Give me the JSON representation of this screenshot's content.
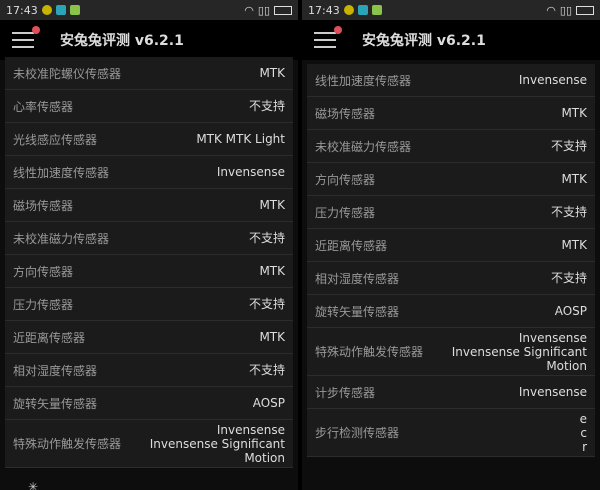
{
  "status": {
    "time": "17:43"
  },
  "header": {
    "title": "安兔兔评测 v6.2.1"
  },
  "left_rows": [
    {
      "name": "未校准陀螺仪传感器",
      "value": "MTK"
    },
    {
      "name": "心率传感器",
      "value": "不支持"
    },
    {
      "name": "光线感应传感器",
      "value": "MTK MTK Light"
    },
    {
      "name": "线性加速度传感器",
      "value": "Invensense"
    },
    {
      "name": "磁场传感器",
      "value": "MTK"
    },
    {
      "name": "未校准磁力传感器",
      "value": "不支持"
    },
    {
      "name": "方向传感器",
      "value": "MTK"
    },
    {
      "name": "压力传感器",
      "value": "不支持"
    },
    {
      "name": "近距离传感器",
      "value": "MTK"
    },
    {
      "name": "相对湿度传感器",
      "value": "不支持"
    },
    {
      "name": "旋转矢量传感器",
      "value": "AOSP"
    },
    {
      "name": "特殊动作触发传感器",
      "value": "Invensense\nInvensense Significant\nMotion",
      "tall": true
    }
  ],
  "right_rows": [
    {
      "name": "线性加速度传感器",
      "value": "Invensense"
    },
    {
      "name": "磁场传感器",
      "value": "MTK"
    },
    {
      "name": "未校准磁力传感器",
      "value": "不支持"
    },
    {
      "name": "方向传感器",
      "value": "MTK"
    },
    {
      "name": "压力传感器",
      "value": "不支持"
    },
    {
      "name": "近距离传感器",
      "value": "MTK"
    },
    {
      "name": "相对湿度传感器",
      "value": "不支持"
    },
    {
      "name": "旋转矢量传感器",
      "value": "AOSP"
    },
    {
      "name": "特殊动作触发传感器",
      "value": "Invensense\nInvensense Significant\nMotion",
      "tall": true
    },
    {
      "name": "计步传感器",
      "value": "Invensense"
    },
    {
      "name": "步行检测传感器",
      "value": "e\nc\nr",
      "tall": true
    }
  ]
}
